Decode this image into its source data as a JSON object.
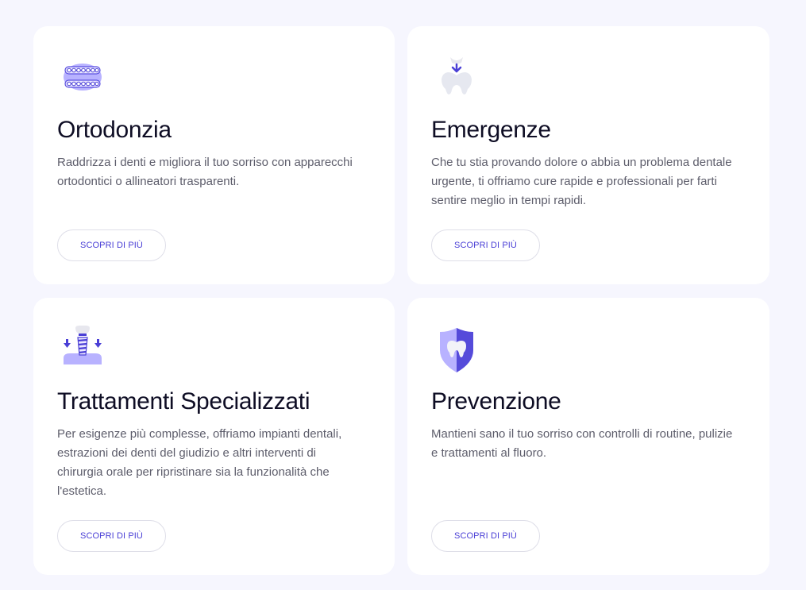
{
  "services": [
    {
      "title": "Ortodonzia",
      "description": "Raddrizza i denti e migliora il tuo sorriso con apparecchi ortodontici o allineatori trasparenti.",
      "button_label": "SCOPRI DI PIÙ",
      "icon": "braces-icon"
    },
    {
      "title": "Emergenze",
      "description": "Che tu stia provando dolore o abbia un problema dentale urgente, ti offriamo cure rapide e professionali per farti sentire meglio in tempi rapidi.",
      "button_label": "SCOPRI DI PIÙ",
      "icon": "tooth-emergency-icon"
    },
    {
      "title": "Trattamenti Specializzati",
      "description": "Per esigenze più complesse, offriamo impianti dentali, estrazioni dei denti del giudizio e altri interventi di chirurgia orale per ripristinare sia la funzionalità che l'estetica.",
      "button_label": "SCOPRI DI PIÙ",
      "icon": "dental-implant-icon"
    },
    {
      "title": "Prevenzione",
      "description": "Mantieni sano il tuo sorriso con controlli di routine, pulizie e trattamenti al fluoro.",
      "button_label": "SCOPRI DI PIÙ",
      "icon": "tooth-shield-icon"
    }
  ],
  "colors": {
    "page_background": "#f6f6fe",
    "card_background": "#ffffff",
    "accent": "#4a3fd6",
    "accent_light": "#b8b2ff",
    "title_text": "#0e0d24",
    "body_text": "#5d5d6b"
  }
}
